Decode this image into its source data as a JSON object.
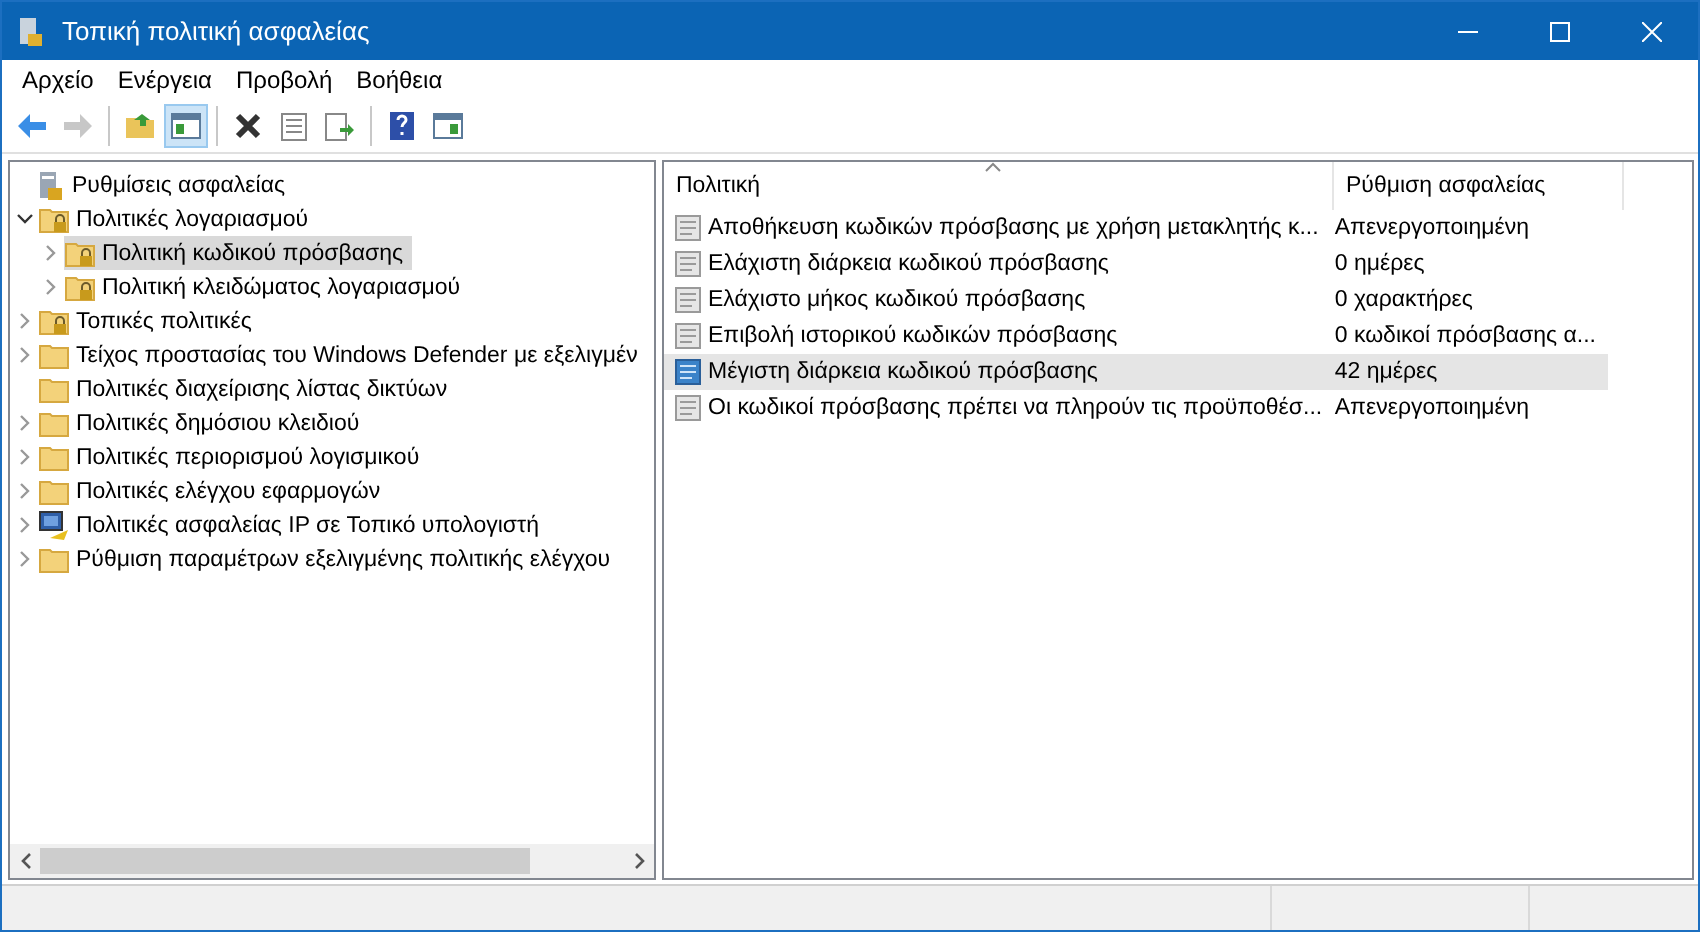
{
  "window": {
    "title": "Τοπική πολιτική ασφαλείας"
  },
  "menu": [
    "Αρχείο",
    "Ενέργεια",
    "Προβολή",
    "Βοήθεια"
  ],
  "toolbar": [
    [
      {
        "kind": "back",
        "pressed": false,
        "disabled": false
      },
      {
        "kind": "forward",
        "pressed": false,
        "disabled": true
      }
    ],
    [
      {
        "kind": "up",
        "pressed": false,
        "disabled": false
      },
      {
        "kind": "tree",
        "pressed": true,
        "disabled": false
      }
    ],
    [
      {
        "kind": "delete",
        "pressed": false,
        "disabled": false
      },
      {
        "kind": "properties",
        "pressed": false,
        "disabled": false
      },
      {
        "kind": "export",
        "pressed": false,
        "disabled": false
      }
    ],
    [
      {
        "kind": "help",
        "pressed": false,
        "disabled": false
      },
      {
        "kind": "view",
        "pressed": false,
        "disabled": false
      }
    ]
  ],
  "tree": [
    {
      "label": "Ρυθμίσεις ασφαλείας",
      "kind": "root",
      "selected": false,
      "children": [
        {
          "label": "Πολιτικές λογαριασμού",
          "kind": "lockfolder",
          "expanded": true,
          "selected": false,
          "children": [
            {
              "label": "Πολιτική κωδικού πρόσβασης",
              "kind": "lockfolder",
              "expanded": false,
              "selected": true
            },
            {
              "label": "Πολιτική κλειδώματος λογαριασμού",
              "kind": "lockfolder",
              "expanded": false,
              "selected": false
            }
          ]
        },
        {
          "label": "Τοπικές πολιτικές",
          "kind": "lockfolder",
          "expanded": false,
          "selected": false
        },
        {
          "label": "Τείχος προστασίας του Windows Defender με εξελιγμέν",
          "kind": "folder",
          "expanded": false,
          "selected": false
        },
        {
          "label": "Πολιτικές διαχείρισης λίστας δικτύων",
          "kind": "folder",
          "selected": false
        },
        {
          "label": "Πολιτικές δημόσιου κλειδιού",
          "kind": "folder",
          "expanded": false,
          "selected": false
        },
        {
          "label": "Πολιτικές περιορισμού λογισμικού",
          "kind": "folder",
          "expanded": false,
          "selected": false
        },
        {
          "label": "Πολιτικές ελέγχου εφαρμογών",
          "kind": "folder",
          "expanded": false,
          "selected": false
        },
        {
          "label": "Πολιτικές ασφαλείας IP σε Τοπικό υπολογιστή",
          "kind": "computer",
          "expanded": false,
          "selected": false
        },
        {
          "label": "Ρύθμιση παραμέτρων εξελιγμένης πολιτικής ελέγχου",
          "kind": "folder",
          "expanded": false,
          "selected": false
        }
      ]
    }
  ],
  "table": {
    "columns": [
      "Πολιτική",
      "Ρύθμιση ασφαλείας"
    ],
    "rows": [
      {
        "policy": "Αποθήκευση κωδικών πρόσβασης με χρήση μετακλητής κ...",
        "setting": "Απενεργοποιημένη",
        "selected": false
      },
      {
        "policy": "Ελάχιστη διάρκεια κωδικού πρόσβασης",
        "setting": "0 ημέρες",
        "selected": false
      },
      {
        "policy": "Ελάχιστο μήκος κωδικού πρόσβασης",
        "setting": "0 χαρακτήρες",
        "selected": false
      },
      {
        "policy": "Επιβολή ιστορικού κωδικών πρόσβασης",
        "setting": "0 κωδικοί πρόσβασης α...",
        "selected": false
      },
      {
        "policy": "Μέγιστη διάρκεια κωδικού πρόσβασης",
        "setting": "42 ημέρες",
        "selected": true
      },
      {
        "policy": "Οι κωδικοί πρόσβασης πρέπει να πληρούν τις προϋποθέσ...",
        "setting": "Απενεργοποιημένη",
        "selected": false
      }
    ]
  }
}
